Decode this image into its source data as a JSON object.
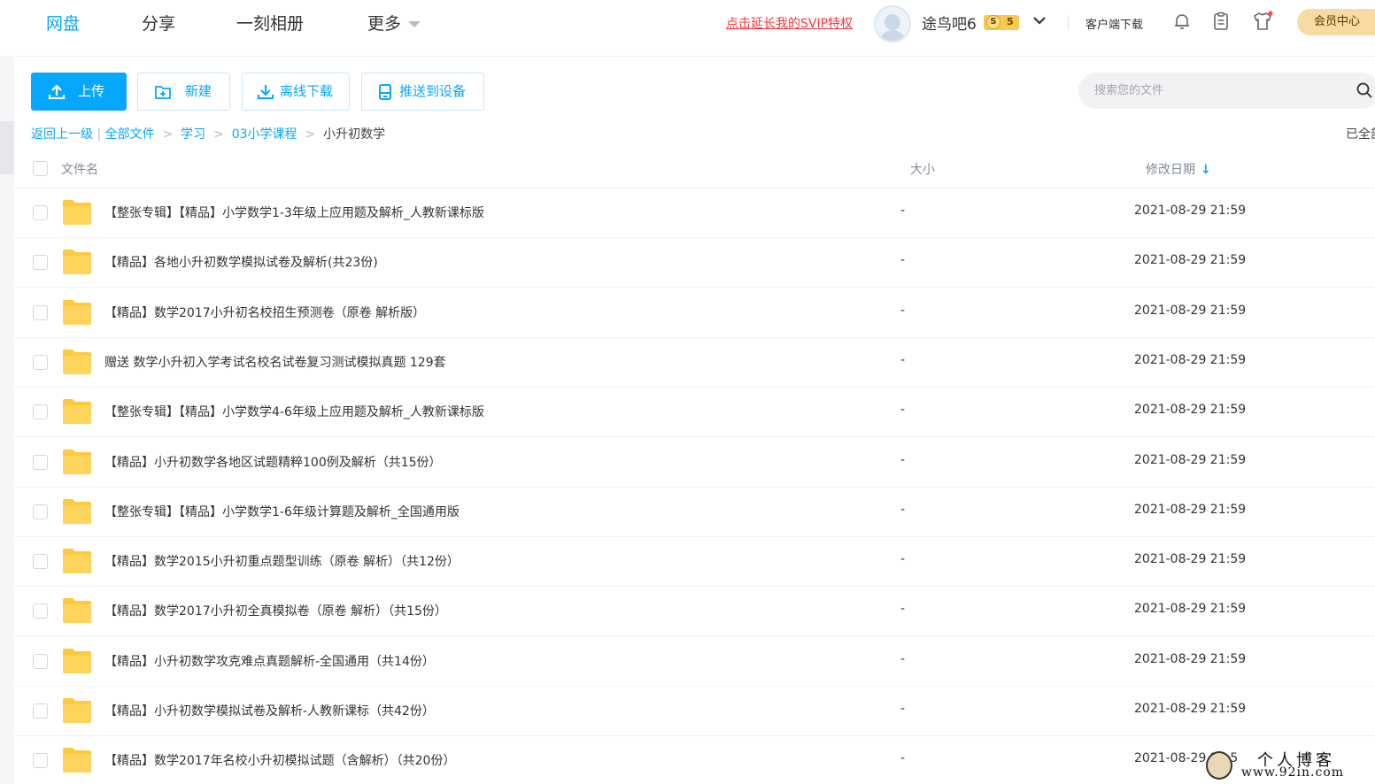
{
  "nav": {
    "tabs": [
      {
        "label": "网盘",
        "active": true
      },
      {
        "label": "分享"
      },
      {
        "label": "一刻相册"
      },
      {
        "label": "更多"
      }
    ],
    "svip_link": "点击延长我的SVIP特权",
    "username": "途鸟吧6",
    "vip_level": "5",
    "vip_icon": "S",
    "client_download": "客户端下载",
    "member_center": "会员中心"
  },
  "toolbar": {
    "upload": "上传",
    "new": "新建",
    "offline_download": "离线下载",
    "push_to_device": "推送到设备"
  },
  "search": {
    "placeholder": "搜索您的文件"
  },
  "breadcrumb": {
    "back": "返回上一级",
    "divider": "|",
    "items": [
      "全部文件",
      "学习",
      "03小学课程"
    ],
    "current": "小升初数学",
    "status": "已全部"
  },
  "table": {
    "columns": {
      "name": "文件名",
      "size": "大小",
      "date": "修改日期"
    },
    "rows": [
      {
        "name": "【整张专辑】【精品】小学数学1-3年级上应用题及解析_人教新课标版",
        "size": "-",
        "date": "2021-08-29 21:59"
      },
      {
        "name": "【精品】各地小升初数学模拟试卷及解析(共23份)",
        "size": "-",
        "date": "2021-08-29 21:59"
      },
      {
        "name": "【精品】数学2017小升初名校招生预测卷（原卷 解析版）",
        "size": "-",
        "date": "2021-08-29 21:59"
      },
      {
        "name": "赠送 数学小升初入学考试名校名试卷复习测试模拟真题 129套",
        "size": "-",
        "date": "2021-08-29 21:59"
      },
      {
        "name": "【整张专辑】【精品】小学数学4-6年级上应用题及解析_人教新课标版",
        "size": "-",
        "date": "2021-08-29 21:59"
      },
      {
        "name": "【精品】小升初数学各地区试题精粹100例及解析（共15份）",
        "size": "-",
        "date": "2021-08-29 21:59"
      },
      {
        "name": "【整张专辑】【精品】小学数学1-6年级计算题及解析_全国通用版",
        "size": "-",
        "date": "2021-08-29 21:59"
      },
      {
        "name": "【精品】数学2015小升初重点题型训练（原卷 解析）（共12份）",
        "size": "-",
        "date": "2021-08-29 21:59"
      },
      {
        "name": "【精品】数学2017小升初全真模拟卷（原卷 解析）（共15份）",
        "size": "-",
        "date": "2021-08-29 21:59"
      },
      {
        "name": "【精品】小升初数学攻克难点真题解析-全国通用（共14份）",
        "size": "-",
        "date": "2021-08-29 21:59"
      },
      {
        "name": "【精品】小升初数学模拟试卷及解析-人教新课标（共42份）",
        "size": "-",
        "date": "2021-08-29 21:59"
      },
      {
        "name": "【精品】数学2017年名校小升初模拟试题（含解析）（共20份）",
        "size": "-",
        "date": "2021-08-29 21:5"
      }
    ]
  },
  "watermark": {
    "title": "个人博客",
    "url": "www.92in.com"
  },
  "colors": {
    "accent": "#06a7ff",
    "svip_link": "#ff3333",
    "folder": "#ffc93c",
    "member_bg": "#f8dba0"
  },
  "icons": {
    "upload": "upload-icon",
    "new": "new-folder-icon",
    "offline": "download-icon",
    "push": "device-icon",
    "search": "search-icon",
    "bell": "bell-icon",
    "clipboard": "clipboard-icon",
    "shirt": "shirt-icon"
  }
}
